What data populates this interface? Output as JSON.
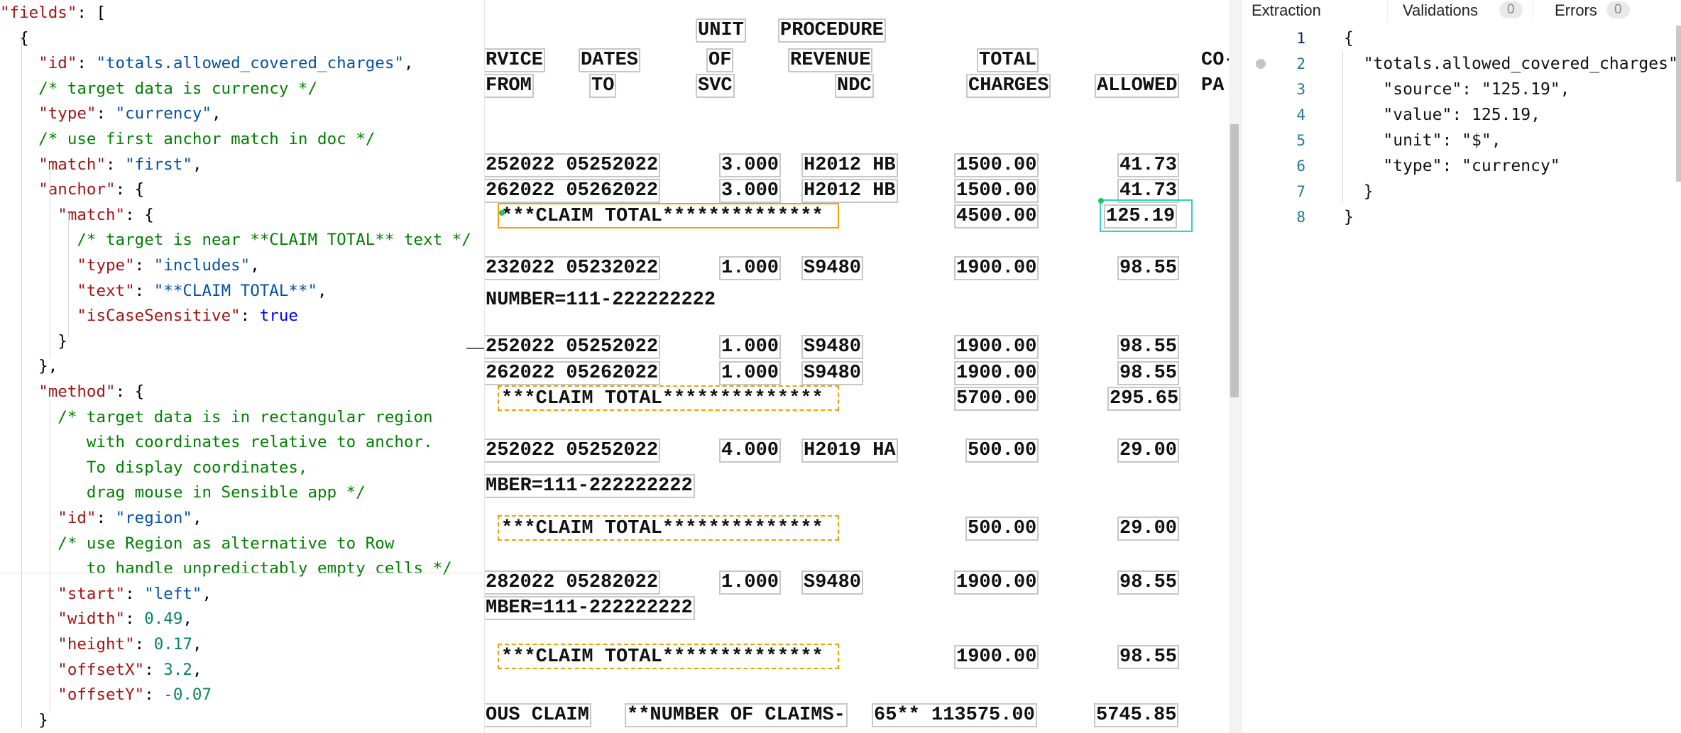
{
  "editor": {
    "lines": [
      [
        [
          "k",
          "\"fields\""
        ],
        [
          "p",
          ": ["
        ]
      ],
      [
        [
          "p",
          "  {"
        ]
      ],
      [
        [
          "p",
          "    "
        ],
        [
          "k",
          "\"id\""
        ],
        [
          "p",
          ": "
        ],
        [
          "s",
          "\"totals.allowed_covered_charges\""
        ],
        [
          "p",
          ","
        ]
      ],
      [
        [
          "c",
          "    /* target data is currency */"
        ]
      ],
      [
        [
          "p",
          "    "
        ],
        [
          "k",
          "\"type\""
        ],
        [
          "p",
          ": "
        ],
        [
          "s",
          "\"currency\""
        ],
        [
          "p",
          ","
        ]
      ],
      [
        [
          "c",
          "    /* use first anchor match in doc */"
        ]
      ],
      [
        [
          "p",
          "    "
        ],
        [
          "k",
          "\"match\""
        ],
        [
          "p",
          ": "
        ],
        [
          "s",
          "\"first\""
        ],
        [
          "p",
          ","
        ]
      ],
      [
        [
          "p",
          "    "
        ],
        [
          "k",
          "\"anchor\""
        ],
        [
          "p",
          ": {"
        ]
      ],
      [
        [
          "p",
          "      "
        ],
        [
          "k",
          "\"match\""
        ],
        [
          "p",
          ": {"
        ]
      ],
      [
        [
          "c",
          "        /* target is near **CLAIM TOTAL** text */"
        ]
      ],
      [
        [
          "p",
          "        "
        ],
        [
          "k",
          "\"type\""
        ],
        [
          "p",
          ": "
        ],
        [
          "s",
          "\"includes\""
        ],
        [
          "p",
          ","
        ]
      ],
      [
        [
          "p",
          "        "
        ],
        [
          "k",
          "\"text\""
        ],
        [
          "p",
          ": "
        ],
        [
          "s",
          "\"**CLAIM TOTAL**\""
        ],
        [
          "p",
          ","
        ]
      ],
      [
        [
          "p",
          "        "
        ],
        [
          "k",
          "\"isCaseSensitive\""
        ],
        [
          "p",
          ": "
        ],
        [
          "b",
          "true"
        ]
      ],
      [
        [
          "p",
          "      }"
        ]
      ],
      [
        [
          "p",
          "    },"
        ]
      ],
      [
        [
          "p",
          "    "
        ],
        [
          "k",
          "\"method\""
        ],
        [
          "p",
          ": {"
        ]
      ],
      [
        [
          "c",
          "      /* target data is in rectangular region"
        ]
      ],
      [
        [
          "c",
          "         with coordinates relative to anchor."
        ]
      ],
      [
        [
          "c",
          "         To display coordinates,"
        ]
      ],
      [
        [
          "c",
          "         drag mouse in Sensible app */"
        ]
      ],
      [
        [
          "p",
          "      "
        ],
        [
          "k",
          "\"id\""
        ],
        [
          "p",
          ": "
        ],
        [
          "s",
          "\"region\""
        ],
        [
          "p",
          ","
        ]
      ],
      [
        [
          "c",
          "      /* use Region as alternative to Row"
        ]
      ],
      [
        [
          "c",
          "         to handle unpredictably empty cells */"
        ]
      ],
      [
        [
          "p",
          "      "
        ],
        [
          "k",
          "\"start\""
        ],
        [
          "p",
          ": "
        ],
        [
          "s",
          "\"left\""
        ],
        [
          "p",
          ","
        ]
      ],
      [
        [
          "p",
          "      "
        ],
        [
          "k",
          "\"width\""
        ],
        [
          "p",
          ": "
        ],
        [
          "n",
          "0.49"
        ],
        [
          "p",
          ","
        ]
      ],
      [
        [
          "p",
          "      "
        ],
        [
          "k",
          "\"height\""
        ],
        [
          "p",
          ": "
        ],
        [
          "n",
          "0.17"
        ],
        [
          "p",
          ","
        ]
      ],
      [
        [
          "p",
          "      "
        ],
        [
          "k",
          "\"offsetX\""
        ],
        [
          "p",
          ": "
        ],
        [
          "n",
          "3.2"
        ],
        [
          "p",
          ","
        ]
      ],
      [
        [
          "p",
          "      "
        ],
        [
          "k",
          "\"offsetY\""
        ],
        [
          "p",
          ": "
        ],
        [
          "n",
          "-0.07"
        ]
      ],
      [
        [
          "p",
          "    }"
        ]
      ]
    ]
  },
  "document": {
    "header_tokens": [
      "UNIT",
      "PROCEDURE",
      "RVICE",
      "DATES",
      "OF",
      "REVENUE",
      "TOTAL",
      "CO-",
      "FROM",
      "TO",
      "SVC",
      "NDC",
      "CHARGES",
      "ALLOWED",
      "PA"
    ],
    "rows": [
      {
        "dates": "252022 05252022",
        "units": "3.000",
        "code": "H2012 HB",
        "total": "1500.00",
        "allowed": "41.73"
      },
      {
        "dates": "262022 05262022",
        "units": "3.000",
        "code": "H2012 HB",
        "total": "1500.00",
        "allowed": "41.73"
      },
      {
        "claim_total": "***CLAIM TOTAL**************",
        "total": "4500.00",
        "allowed": "125.19"
      },
      {
        "dates": "232022 05232022",
        "units": "1.000",
        "code": "S9480",
        "total": "1900.00",
        "allowed": "98.55"
      },
      {
        "number": "NUMBER=111-222222222"
      },
      {
        "dates": "252022 05252022",
        "units": "1.000",
        "code": "S9480",
        "total": "1900.00",
        "allowed": "98.55"
      },
      {
        "dates": "262022 05262022",
        "units": "1.000",
        "code": "S9480",
        "total": "1900.00",
        "allowed": "98.55"
      },
      {
        "claim_total": "***CLAIM TOTAL**************",
        "total": "5700.00",
        "allowed": "295.65"
      },
      {
        "dates": "252022 05252022",
        "units": "4.000",
        "code": "H2019 HA",
        "total": "500.00",
        "allowed": "29.00"
      },
      {
        "number": "MBER=111-222222222"
      },
      {
        "claim_total": "***CLAIM TOTAL**************",
        "total": "500.00",
        "allowed": "29.00"
      },
      {
        "dates": "282022 05282022",
        "units": "1.000",
        "code": "S9480",
        "total": "1900.00",
        "allowed": "98.55"
      },
      {
        "number": "MBER=111-222222222"
      },
      {
        "claim_total": "***CLAIM TOTAL**************",
        "total": "1900.00",
        "allowed": "98.55"
      },
      {
        "footer_a": "OUS CLAIM",
        "footer_b": "**NUMBER OF CLAIMS-",
        "footer_c": "65** 113575.00",
        "allowed": "5745.85"
      }
    ]
  },
  "output": {
    "tabs": [
      {
        "label": "Extraction",
        "count": ""
      },
      {
        "label": "Validations",
        "count": "0"
      },
      {
        "label": "Errors",
        "count": "0"
      }
    ],
    "line_numbers": [
      "1",
      "2",
      "3",
      "4",
      "5",
      "6",
      "7",
      "8"
    ],
    "lines": [
      "{",
      "  \"totals.allowed_covered_charges\": {",
      "    \"source\": \"125.19\",",
      "    \"value\": 125.19,",
      "    \"unit\": \"$\",",
      "    \"type\": \"currency\"",
      "  }",
      "}"
    ]
  },
  "colors": {
    "anchor_highlight": "#f4a000",
    "target_highlight": "#2fd1c8",
    "json_key": "#a31515",
    "json_string": "#0451a5",
    "json_number": "#098658",
    "comment": "#008000"
  }
}
